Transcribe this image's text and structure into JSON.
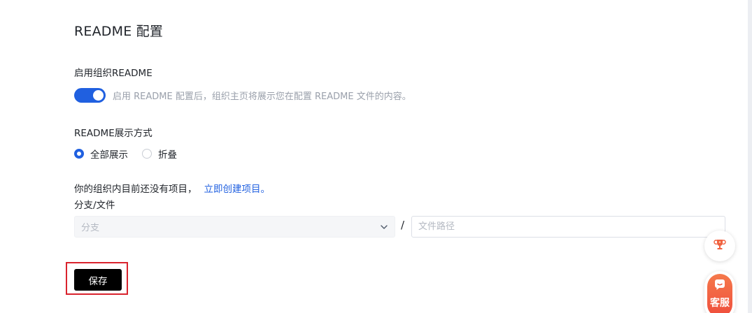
{
  "page": {
    "title": "README 配置"
  },
  "readme_toggle": {
    "label": "启用组织README",
    "enabled": true,
    "description": "启用 README 配置后，组织主页将展示您在配置 README 文件的内容。"
  },
  "display_mode": {
    "label": "README展示方式",
    "options": [
      {
        "label": "全部展示",
        "checked": true
      },
      {
        "label": "折叠",
        "checked": false
      }
    ]
  },
  "notice": {
    "text": "你的组织内目前还没有项目，",
    "link": "立即创建项目。"
  },
  "branch_file": {
    "label": "分支/文件",
    "branch_placeholder": "分支",
    "separator": "/",
    "path_placeholder": "文件路径",
    "path_value": ""
  },
  "actions": {
    "save_label": "保存"
  },
  "floating": {
    "trophy_icon": "trophy-icon",
    "service_icon": "chat-bubble-icon",
    "service_label": "客服"
  },
  "colors": {
    "primary": "#2060e0",
    "save_button": "#000000",
    "highlight": "#d9232d",
    "service_gradient_top": "#f5794b",
    "service_gradient_bottom": "#ef4d3c"
  }
}
